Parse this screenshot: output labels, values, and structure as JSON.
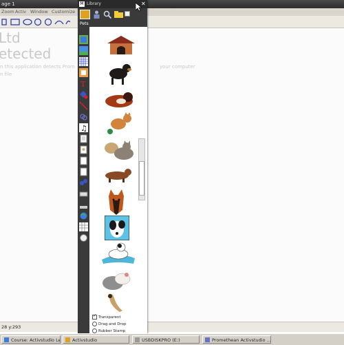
{
  "window": {
    "title": "age 1"
  },
  "menu": [
    "Zoom",
    "Activ",
    "Window",
    "Customize"
  ],
  "canvas": {
    "big_lines": [
      "Ltd",
      "etected"
    ],
    "small_lines": [
      "n this application detects Prom",
      "your computer",
      "n file"
    ]
  },
  "library": {
    "title": "Library",
    "category": "Pets",
    "pets": [
      "dog-house",
      "black-dog",
      "lying-dog",
      "ginger-cat",
      "grey-cat",
      "dachshund",
      "german-shepherd",
      "jack-russell",
      "dog-on-pillow",
      "hamster",
      "ferret"
    ],
    "options": {
      "transparent": "Transparent",
      "drag_and_drop": "Drag and Drop",
      "rubber_stamp": "Rubber Stamp"
    }
  },
  "status": {
    "coords": "28 y:293"
  },
  "taskbar": [
    {
      "label": "Course: Activstudio Leve..."
    },
    {
      "label": "Activstudio"
    },
    {
      "label": "USBDISKPRO (E:)"
    },
    {
      "label": "Promethean Activstudio ..."
    }
  ],
  "colors": {
    "accent": "#e0a020",
    "dark_panel": "#3a3a3a"
  }
}
